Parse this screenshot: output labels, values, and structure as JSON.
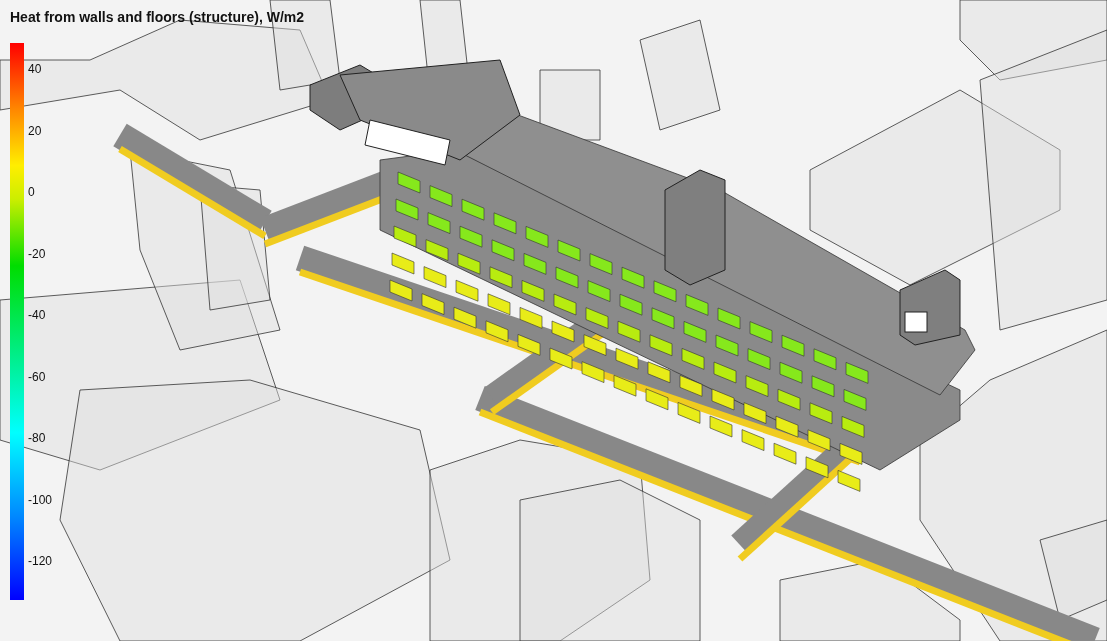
{
  "title": "Heat from walls and floors (structure), W/m2",
  "legend": {
    "ticks": [
      "40",
      "20",
      "0",
      "-20",
      "-40",
      "-60",
      "-80",
      "-100",
      "-120"
    ]
  }
}
